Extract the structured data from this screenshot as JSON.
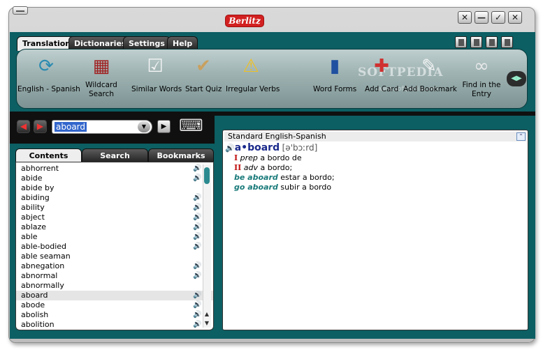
{
  "window": {
    "brand": "Berlitz",
    "controls": [
      "✕",
      "—",
      "✓",
      "✕"
    ]
  },
  "tabs": [
    "Translation",
    "Dictionaries",
    "Settings",
    "Help"
  ],
  "toolbar": {
    "items": [
      {
        "label": "English - Spanish",
        "icon": "refresh-arrows-icon"
      },
      {
        "label": "Wildcard\nSearch",
        "icon": "crossword-icon"
      },
      {
        "label": "Similar Words",
        "icon": "checklist-icon"
      },
      {
        "label": "Start Quiz",
        "icon": "quiz-box-icon"
      },
      {
        "label": "Irregular Verbs",
        "icon": "warning-book-icon"
      },
      {
        "label": "Word Forms",
        "icon": "books-icon"
      },
      {
        "label": "Add Card",
        "icon": "add-card-icon"
      },
      {
        "label": "Add Bookmark",
        "icon": "bookmark-note-icon"
      },
      {
        "label": "Find in the\nEntry",
        "icon": "binoculars-icon"
      }
    ],
    "watermark": "SOFTPEDIA",
    "watermark_url": "www.softpedia.com"
  },
  "search": {
    "value": "aboard"
  },
  "left_tabs": [
    "Contents",
    "Search",
    "Bookmarks"
  ],
  "wordlist": [
    {
      "word": "abhorrent",
      "audio": true
    },
    {
      "word": "abide",
      "audio": true
    },
    {
      "word": "abide by",
      "audio": false
    },
    {
      "word": "abiding",
      "audio": true
    },
    {
      "word": "ability",
      "audio": true
    },
    {
      "word": "abject",
      "audio": true
    },
    {
      "word": "ablaze",
      "audio": true
    },
    {
      "word": "able",
      "audio": true
    },
    {
      "word": "able-bodied",
      "audio": true
    },
    {
      "word": "able seaman",
      "audio": false
    },
    {
      "word": "abnegation",
      "audio": true
    },
    {
      "word": "abnormal",
      "audio": true
    },
    {
      "word": "abnormally",
      "audio": false
    },
    {
      "word": "aboard",
      "audio": true,
      "selected": true
    },
    {
      "word": "abode",
      "audio": true
    },
    {
      "word": "abolish",
      "audio": true
    },
    {
      "word": "abolition",
      "audio": true
    }
  ],
  "entry": {
    "dictionary": "Standard English-Spanish",
    "headword": "a•board",
    "pronunciation": "[ə'bɔːrd]",
    "senses": [
      {
        "num": "I",
        "pos": "prep",
        "translation": "a bordo de"
      },
      {
        "num": "II",
        "pos": "adv",
        "translation": "a bordo;"
      }
    ],
    "phrases": [
      {
        "phrase": "be aboard",
        "translation": "estar a bordo;"
      },
      {
        "phrase": "go aboard",
        "translation": "subir a bordo"
      }
    ]
  }
}
